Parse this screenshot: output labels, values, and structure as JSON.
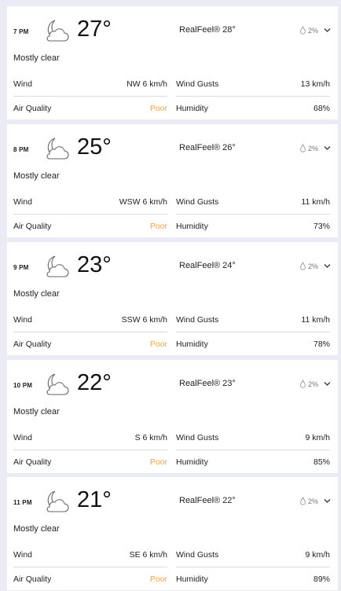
{
  "labels": {
    "realfeel_prefix": "RealFeel®",
    "wind": "Wind",
    "wind_gusts": "Wind Gusts",
    "air_quality": "Air Quality",
    "humidity": "Humidity"
  },
  "colors": {
    "poor": "#f0a540",
    "background": "#ebebf5",
    "card": "#ffffff"
  },
  "hours": [
    {
      "time": "7 PM",
      "icon": "moon-cloud-icon",
      "temp": "27°",
      "realfeel": "RealFeel® 28°",
      "precip": "2%",
      "phrase": "Mostly clear",
      "wind": "NW 6 km/h",
      "wind_gusts": "13 km/h",
      "air_quality": "Poor",
      "humidity": "68%"
    },
    {
      "time": "8 PM",
      "icon": "moon-cloud-icon",
      "temp": "25°",
      "realfeel": "RealFeel® 26°",
      "precip": "2%",
      "phrase": "Mostly clear",
      "wind": "WSW 6 km/h",
      "wind_gusts": "11 km/h",
      "air_quality": "Poor",
      "humidity": "73%"
    },
    {
      "time": "9 PM",
      "icon": "moon-cloud-icon",
      "temp": "23°",
      "realfeel": "RealFeel® 24°",
      "precip": "2%",
      "phrase": "Mostly clear",
      "wind": "SSW 6 km/h",
      "wind_gusts": "11 km/h",
      "air_quality": "Poor",
      "humidity": "78%"
    },
    {
      "time": "10 PM",
      "icon": "moon-cloud-icon",
      "temp": "22°",
      "realfeel": "RealFeel® 23°",
      "precip": "2%",
      "phrase": "Mostly clear",
      "wind": "S 6 km/h",
      "wind_gusts": "9 km/h",
      "air_quality": "Poor",
      "humidity": "85%"
    },
    {
      "time": "11 PM",
      "icon": "moon-cloud-icon",
      "temp": "21°",
      "realfeel": "RealFeel® 22°",
      "precip": "2%",
      "phrase": "Mostly clear",
      "wind": "SE 6 km/h",
      "wind_gusts": "9 km/h",
      "air_quality": "Poor",
      "humidity": "89%"
    }
  ]
}
